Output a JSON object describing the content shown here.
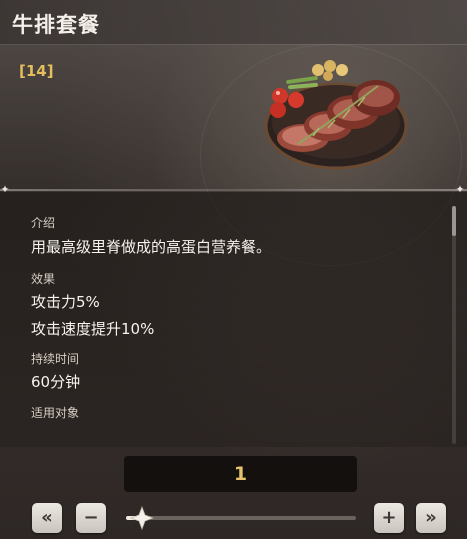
{
  "item": {
    "name": "牛排套餐",
    "level": "[14]"
  },
  "details": {
    "intro_label": "介绍",
    "intro_text": "用最高级里脊做成的高蛋白营养餐。",
    "effect_label": "效果",
    "effects": [
      "攻击力5%",
      "攻击速度提升10%"
    ],
    "duration_label": "持续时间",
    "duration_value": "60分钟",
    "target_label": "适用对象"
  },
  "quantity": {
    "value": "1",
    "slider_fraction": 0.0,
    "min_button": "«",
    "minus_button": "−",
    "plus_button": "+",
    "max_button": "»"
  },
  "colors": {
    "level_gold": "#e3bd5e",
    "qty_gold": "#e4c36a"
  },
  "icons": [
    "steak-meal-image",
    "sparkle-icon",
    "double-left-icon",
    "minus-icon",
    "plus-icon",
    "double-right-icon",
    "diamond-thumb-icon"
  ]
}
